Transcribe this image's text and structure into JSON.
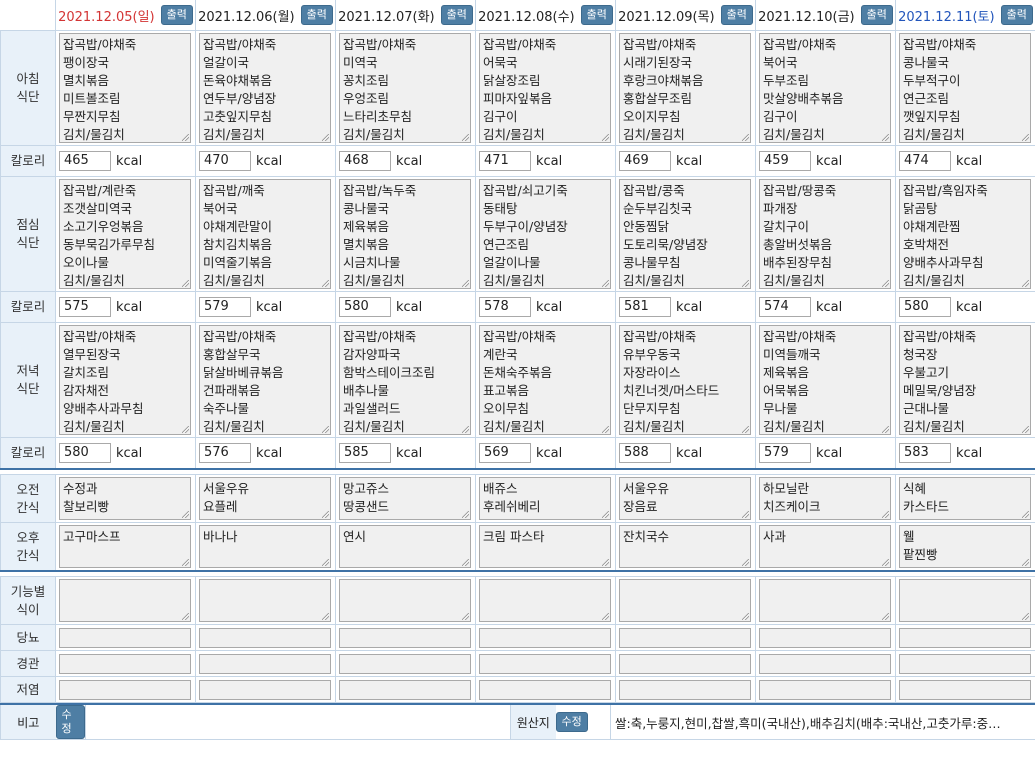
{
  "print_label": "출력",
  "edit_label": "수정",
  "unit": "kcal",
  "days": [
    {
      "date": "2021.12.05(일)",
      "kind": "sun"
    },
    {
      "date": "2021.12.06(월)",
      "kind": "wk"
    },
    {
      "date": "2021.12.07(화)",
      "kind": "wk"
    },
    {
      "date": "2021.12.08(수)",
      "kind": "wk"
    },
    {
      "date": "2021.12.09(목)",
      "kind": "wk"
    },
    {
      "date": "2021.12.10(금)",
      "kind": "wk"
    },
    {
      "date": "2021.12.11(토)",
      "kind": "sat"
    }
  ],
  "labels": {
    "breakfast": "아침\n식단",
    "lunch": "점심\n식단",
    "dinner": "저녁\n식단",
    "calorie": "칼로리",
    "am_snack": "오전\n간식",
    "pm_snack": "오후\n간식",
    "functional": "기능별\n식이",
    "diabetes": "당뇨",
    "tube": "경관",
    "lowsalt": "저염",
    "note": "비고",
    "origin": "원산지"
  },
  "breakfast": [
    "잡곡밥/야채죽\n팽이장국\n멸치볶음\n미트볼조림\n무짠지무침\n김치/물김치",
    "잡곡밥/야채죽\n얼갈이국\n돈육야채볶음\n연두부/양념장\n고춧잎지무침\n김치/물김치",
    "잡곡밥/야채죽\n미역국\n꽁치조림\n우엉조림\n느타리초무침\n김치/물김치",
    "잡곡밥/야채죽\n어묵국\n닭살장조림\n피마자잎볶음\n김구이\n김치/물김치",
    "잡곡밥/야채죽\n시래기된장국\n후랑크야채볶음\n홍합살무조림\n오이지무침\n김치/물김치",
    "잡곡밥/야채죽\n북어국\n두부조림\n맛살양배추볶음\n김구이\n김치/물김치",
    "잡곡밥/야채죽\n콩나물국\n두부적구이\n연근조림\n깻잎지무침\n김치/물김치"
  ],
  "breakfast_kcal": [
    "465",
    "470",
    "468",
    "471",
    "469",
    "459",
    "474"
  ],
  "lunch": [
    "잡곡밥/계란죽\n조갯살미역국\n소고기우엉볶음\n동부묵김가루무침\n오이나물\n김치/물김치",
    "잡곡밥/깨죽\n북어국\n야채계란말이\n참치김치볶음\n미역줄기볶음\n김치/물김치",
    "잡곡밥/녹두죽\n콩나물국\n제육볶음\n멸치볶음\n시금치나물\n김치/물김치",
    "잡곡밥/쇠고기죽\n동태탕\n두부구이/양념장\n연근조림\n얼갈이나물\n김치/물김치",
    "잡곡밥/콩죽\n순두부김칫국\n안동찜닭\n도토리묵/양념장\n콩나물무침\n김치/물김치",
    "잡곡밥/땅콩죽\n파개장\n갈치구이\n총알버섯볶음\n배추된장무침\n김치/물김치",
    "잡곡밥/흑임자죽\n닭곰탕\n야채계란찜\n호박채전\n양배추사과무침\n김치/물김치"
  ],
  "lunch_kcal": [
    "575",
    "579",
    "580",
    "578",
    "581",
    "574",
    "580"
  ],
  "dinner": [
    "잡곡밥/야채죽\n열무된장국\n갈치조림\n감자채전\n양배추사과무침\n김치/물김치",
    "잡곡밥/야채죽\n홍합살무국\n닭살바베큐볶음\n건파래볶음\n숙주나물\n김치/물김치",
    "잡곡밥/야채죽\n감자양파국\n함박스테이크조림\n배추나물\n과일샐러드\n김치/물김치",
    "잡곡밥/야채죽\n계란국\n돈채숙주볶음\n표고볶음\n오이무침\n김치/물김치",
    "잡곡밥/야채죽\n유부우동국\n자장라이스\n치킨너겟/머스타드\n단무지무침\n김치/물김치",
    "잡곡밥/야채죽\n미역들깨국\n제육볶음\n어묵볶음\n무나물\n김치/물김치",
    "잡곡밥/야채죽\n청국장\n우불고기\n메밀묵/양념장\n근대나물\n김치/물김치"
  ],
  "dinner_kcal": [
    "580",
    "576",
    "585",
    "569",
    "588",
    "579",
    "583"
  ],
  "am_snack": [
    "수정과\n찰보리빵",
    "서울우유\n요플레",
    "망고쥬스\n땅콩샌드",
    "배쥬스\n후레쉬베리",
    "서울우유\n장음료",
    "하모닐란\n치즈케이크",
    "식혜\n카스타드"
  ],
  "pm_snack": [
    "고구마스프",
    "바나나",
    "연시",
    "크림 파스타",
    "잔치국수",
    "사과",
    "웰\n팥찐빵"
  ],
  "origin_text": "쌀:축,누룽지,현미,찹쌀,흑미(국내산),배추김치(배추:국내산,고춧가루:중…"
}
